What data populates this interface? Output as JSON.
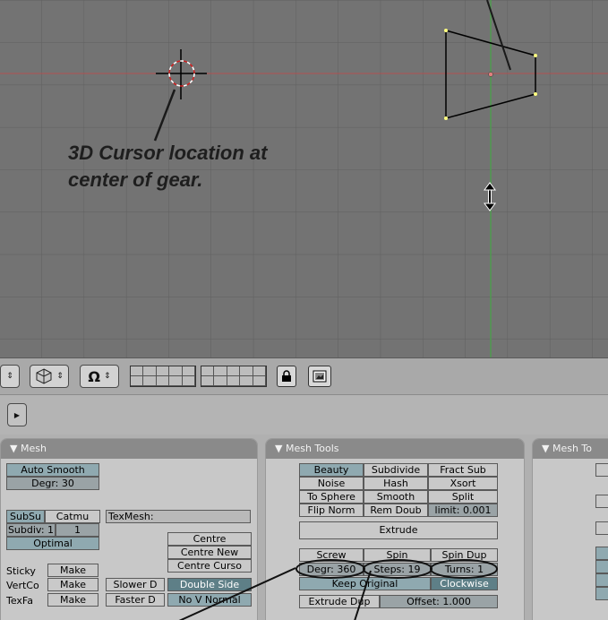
{
  "annotation": {
    "cursor_caption_line1": "3D Cursor location at",
    "cursor_caption_line2": "center of gear."
  },
  "header_bar": {
    "lock_icon": "lock-icon",
    "render_icon": "render-image-icon"
  },
  "mesh_panel": {
    "title": "Mesh",
    "auto_smooth": "Auto Smooth",
    "degr": "Degr: 30",
    "subsurf": "SubSu",
    "catmull": "Catmu",
    "texmesh": "TexMesh:",
    "subdiv": "Subdiv: 1",
    "subdiv_render": "1",
    "optimal": "Optimal",
    "centre": "Centre",
    "centre_new": "Centre New",
    "centre_cursor": "Centre Curso",
    "sticky": "Sticky",
    "vertcol": "VertCo",
    "texface": "TexFa",
    "make": "Make",
    "slower_draw": "Slower D",
    "faster_draw": "Faster D",
    "double_sided": "Double Side",
    "no_v_normal": "No V Normal"
  },
  "mesh_tools_panel": {
    "title": "Mesh Tools",
    "row1": [
      "Beauty",
      "Subdivide",
      "Fract Sub"
    ],
    "row2": [
      "Noise",
      "Hash",
      "Xsort"
    ],
    "row3": [
      "To Sphere",
      "Smooth",
      "Split"
    ],
    "row4": [
      "Flip Norm",
      "Rem Doub",
      "limit: 0.001"
    ],
    "extrude": "Extrude",
    "row6": [
      "Screw",
      "Spin",
      "Spin Dup"
    ],
    "degr": "Degr: 360",
    "steps": "Steps: 19",
    "turns": "Turns: 1",
    "keep_original": "Keep Original",
    "clockwise": "Clockwise",
    "extrude_dup": "Extrude Dup",
    "offset": "Offset: 1.000"
  },
  "mesh_tools1_panel": {
    "title": "Mesh To"
  }
}
